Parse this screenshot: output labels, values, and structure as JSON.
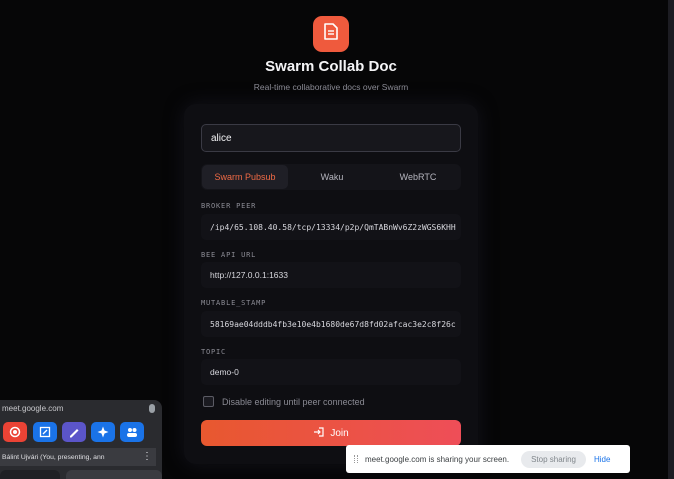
{
  "app": {
    "title": "Swarm Collab Doc",
    "subtitle": "Real-time collaborative docs over Swarm",
    "logo_icon": "document-icon",
    "accent_color": "#ef5a3d"
  },
  "form": {
    "username_value": "alice",
    "tabs": [
      {
        "label": "Swarm Pubsub",
        "active": true
      },
      {
        "label": "Waku",
        "active": false
      },
      {
        "label": "WebRTC",
        "active": false
      }
    ],
    "broker_peer_label": "BROKER PEER",
    "broker_peer_value": "/ip4/65.108.40.58/tcp/13334/p2p/QmTABnWv6Z2zWGS6KHH",
    "bee_api_label": "BEE API URL",
    "bee_api_value": "http://127.0.0.1:1633",
    "stamp_label": "MUTABLE_STAMP",
    "stamp_value": "58169ae04dddb4fb3e10e4b1680de67d8fd02afcac3e2c8f26c",
    "topic_label": "TOPIC",
    "topic_value": "demo-0",
    "checkbox_label": "Disable editing until peer connected",
    "checkbox_checked": false,
    "join_label": "Join",
    "join_icon": "login-icon"
  },
  "meet_panel": {
    "url": "meet.google.com",
    "participant": "Bálint Ujvári (You, presenting, ann",
    "buttons": [
      "record-icon",
      "whiteboard-icon",
      "pen-icon",
      "sparkle-icon",
      "people-icon"
    ]
  },
  "share_bar": {
    "message": "meet.google.com is sharing your screen.",
    "stop_label": "Stop sharing",
    "hide_label": "Hide"
  }
}
